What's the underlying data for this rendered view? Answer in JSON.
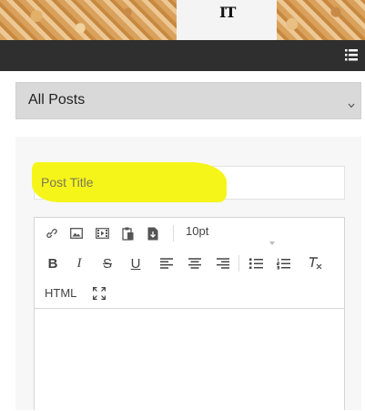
{
  "header": {
    "mark": "IT",
    "menu_icon": "list-icon"
  },
  "filter": {
    "selected": "All Posts",
    "chevron_icon": "chevron-down-icon"
  },
  "post": {
    "title_placeholder": "Post Title",
    "highlight_color": "#f6f51a"
  },
  "editor": {
    "toolbar_row1": [
      "link-icon",
      "image-icon",
      "media-icon",
      "paste-icon",
      "document-icon"
    ],
    "font_size": "10pt",
    "toolbar_row2": [
      "bold",
      "italic",
      "strikethrough",
      "underline",
      "align-left",
      "align-center",
      "align-right",
      "bullet-list",
      "numbered-list",
      "clear-format"
    ],
    "bold_label": "B",
    "italic_label": "I",
    "strike_label": "S",
    "underline_label": "U",
    "html_label": "HTML",
    "fullscreen_icon": "fullscreen-icon"
  }
}
